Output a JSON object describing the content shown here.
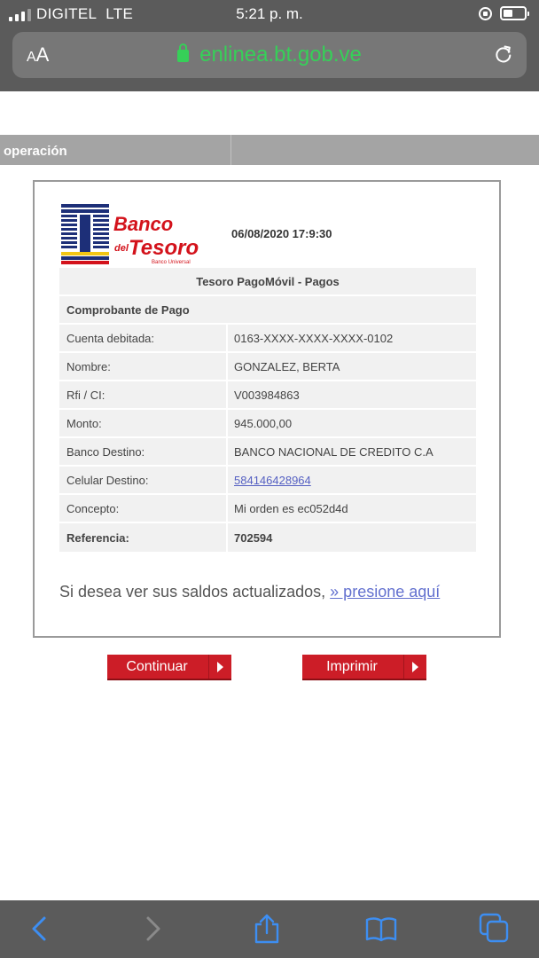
{
  "status_bar": {
    "carrier": "DIGITEL",
    "network": "LTE",
    "time": "5:21 p. m."
  },
  "browser": {
    "aa_small": "A",
    "aa_big": "A",
    "url": "enlinea.bt.gob.ve"
  },
  "section": {
    "title": "operación"
  },
  "logo": {
    "line1": "Banco",
    "line2_small": "del",
    "line2": "Tesoro",
    "tagline": "Banco Universal"
  },
  "receipt": {
    "datetime": "06/08/2020 17:9:30",
    "service_title": "Tesoro PagoMóvil - Pagos",
    "voucher_title": "Comprobante de Pago",
    "rows": [
      {
        "label": "Cuenta debitada:",
        "value": "0163-XXXX-XXXX-XXXX-0102"
      },
      {
        "label": "Nombre:",
        "value": "GONZALEZ, BERTA"
      },
      {
        "label": "Rfi / CI:",
        "value": "V003984863"
      },
      {
        "label": "Monto:",
        "value": "945.000,00"
      },
      {
        "label": "Banco Destino:",
        "value": "BANCO NACIONAL DE CREDITO C.A"
      },
      {
        "label": "Celular Destino:",
        "value": "584146428964"
      },
      {
        "label": "Concepto:",
        "value": "Mi orden es ec052d4d"
      },
      {
        "label": "Referencia:",
        "value": "702594"
      }
    ],
    "saldos_text": "Si desea ver sus saldos actualizados, ",
    "saldos_link": "» presione aquí"
  },
  "buttons": {
    "continuar": "Continuar",
    "imprimir": "Imprimir"
  },
  "toolbar": {
    "icons": [
      "back-icon",
      "forward-icon",
      "share-icon",
      "bookmarks-icon",
      "tabs-icon"
    ]
  },
  "colors": {
    "browser_chrome": "#5b5b5b",
    "url_green": "#36d058",
    "button_red": "#cc1d27",
    "link_blue": "#5560c2",
    "ios_blue": "#3d8ef2"
  }
}
